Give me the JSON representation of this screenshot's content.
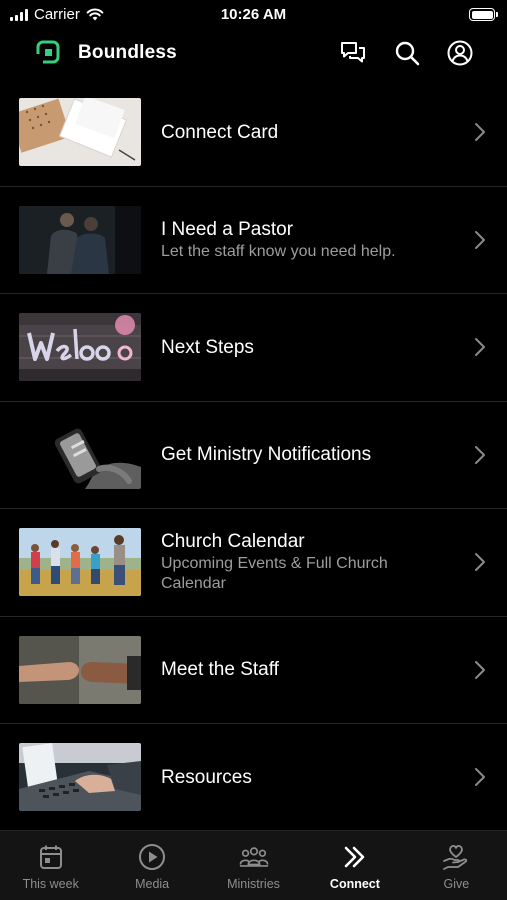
{
  "status_bar": {
    "carrier": "Carrier",
    "time": "10:26 AM"
  },
  "header": {
    "title": "Boundless",
    "logo_color": "#35d07f",
    "icons": [
      "chat-icon",
      "search-icon",
      "profile-icon"
    ]
  },
  "list": {
    "items": [
      {
        "title": "Connect Card",
        "subtitle": ""
      },
      {
        "title": "I Need a Pastor",
        "subtitle": "Let the staff know you need help."
      },
      {
        "title": "Next Steps",
        "subtitle": ""
      },
      {
        "title": "Get Ministry Notifications",
        "subtitle": ""
      },
      {
        "title": "Church Calendar",
        "subtitle": "Upcoming Events & Full Church Calendar"
      },
      {
        "title": "Meet the Staff",
        "subtitle": ""
      },
      {
        "title": "Resources",
        "subtitle": ""
      }
    ]
  },
  "tab_bar": {
    "active": "Connect",
    "tabs": [
      {
        "label": "This week",
        "icon": "calendar-icon"
      },
      {
        "label": "Media",
        "icon": "play-circle-icon"
      },
      {
        "label": "Ministries",
        "icon": "people-icon"
      },
      {
        "label": "Connect",
        "icon": "double-chevron-icon"
      },
      {
        "label": "Give",
        "icon": "heart-hand-icon"
      }
    ]
  },
  "colors": {
    "background": "#000000",
    "tab_bar_background": "#141414",
    "subtitle": "#9d9d9d",
    "inactive_tab": "#8e8e8e"
  }
}
